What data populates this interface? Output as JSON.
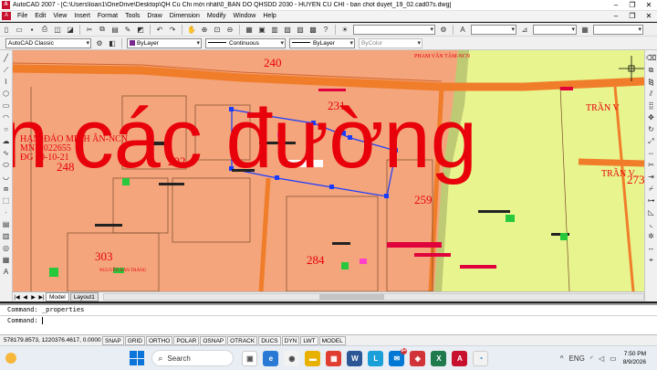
{
  "window": {
    "title": "AutoCAD 2007 - [C:\\Users\\loan1\\OneDrive\\Desktop\\QH Củ Chi mới nhất\\0_BAN DO QHSDD 2030 - HUYEN CU CHI - ban chot duyet_19_02.cad07s.dwg]",
    "minimize": "–",
    "restore": "❐",
    "close": "✕"
  },
  "menu": [
    "File",
    "Edit",
    "View",
    "Insert",
    "Format",
    "Tools",
    "Draw",
    "Dimension",
    "Modify",
    "Window",
    "Help"
  ],
  "props": {
    "workspace": "AutoCAD Classic",
    "color": "ByLayer",
    "linetype": "Continuous",
    "lineweight": "ByLayer",
    "plotstyle": "ByColor"
  },
  "drawing": {
    "overlay_text": "n các đường",
    "labels": {
      "l240": "240",
      "l231": "231",
      "l292": "292",
      "l248": "248",
      "l259": "259",
      "l303": "303",
      "l284": "284",
      "l273": "273",
      "owner1": "HẠM ĐẢO MINH ÂN-NCN",
      "owner2": "MND 022655",
      "owner3": "ĐG 20-10-21",
      "tran1": "TRẦN V",
      "tran2": "TRẦN V",
      "phamvan": "PHAM VĂN TÂM-NCN",
      "nguyen": "NGUYỄN BẢN TRẢNG"
    }
  },
  "tabs": {
    "model": "Model",
    "layout1": "Layout1"
  },
  "command": {
    "line1": "Command: _properties",
    "line2": "Command:"
  },
  "status": {
    "coords": "578179.8573, 1220376.4617, 0.0000",
    "buttons": [
      "SNAP",
      "GRID",
      "ORTHO",
      "POLAR",
      "OSNAP",
      "OTRACK",
      "DUCS",
      "DYN",
      "LWT",
      "MODEL"
    ]
  },
  "taskbar": {
    "search_placeholder": "Search",
    "badge": "9+",
    "lang": "ENG",
    "time": "7:50 PM",
    "date": "8/9/2026"
  },
  "colors": {
    "residential": "#f4a57c",
    "green_land": "#e8f58e",
    "road": "#f07d2a",
    "overlay": "#e8000b"
  }
}
